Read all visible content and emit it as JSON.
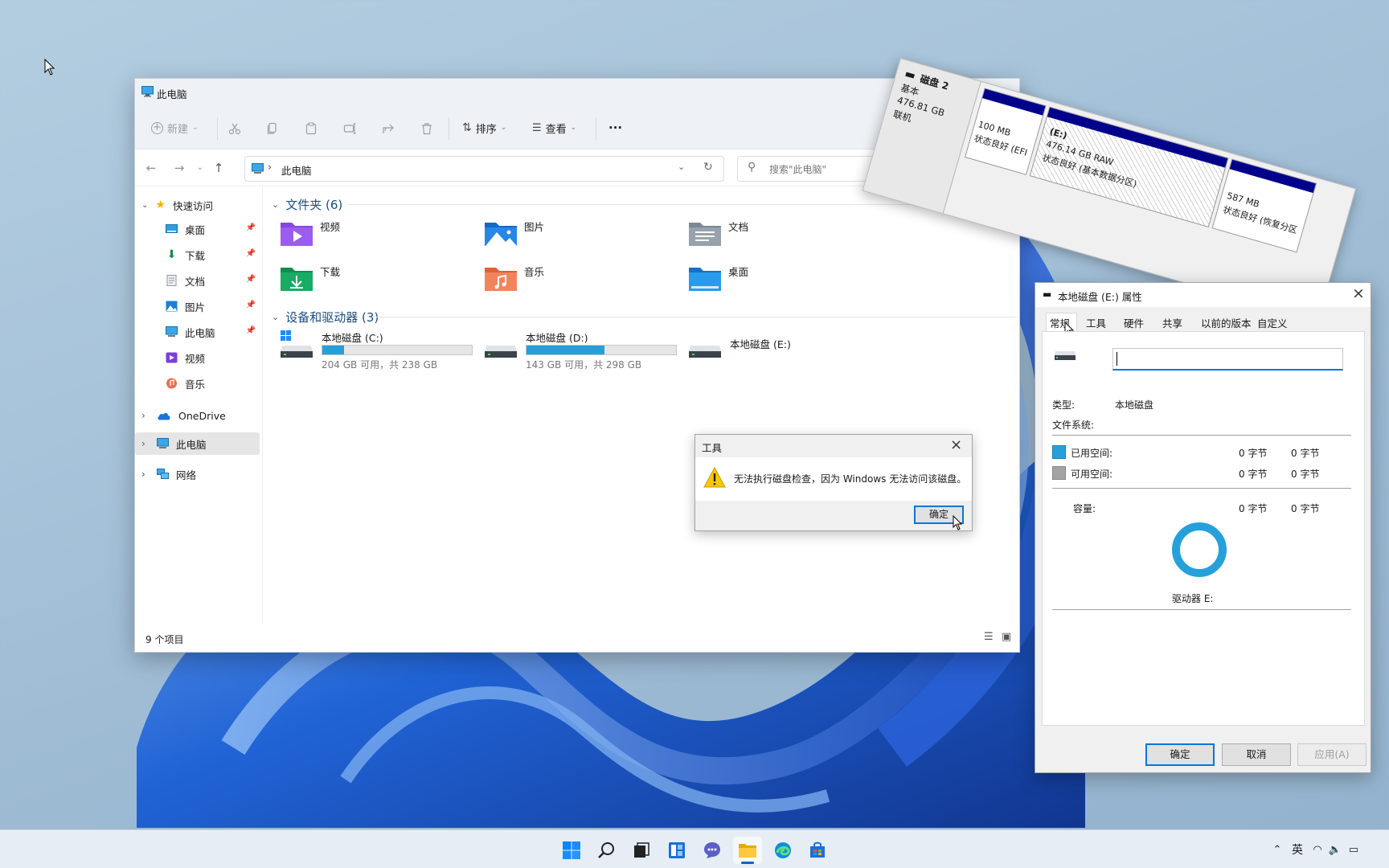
{
  "colors": {
    "accent": "#0078d7",
    "bar": "#26a0da",
    "used_swatch": "#26a0da",
    "free_swatch": "#a3a3a3",
    "disk_header": "#00008b",
    "warning": "#f8c900"
  },
  "explorer": {
    "title": "此电脑",
    "toolbar": {
      "new": "新建",
      "sort": "排序",
      "view": "查看",
      "more": "···"
    },
    "address": {
      "path": "此电脑"
    },
    "search": {
      "placeholder": "搜索\"此电脑\""
    },
    "sidebar": {
      "quick_access": "快速访问",
      "items": [
        {
          "label": "桌面",
          "icon": "desktop-icon",
          "pinned": true
        },
        {
          "label": "下载",
          "icon": "download-icon",
          "pinned": true
        },
        {
          "label": "文档",
          "icon": "document-icon",
          "pinned": true
        },
        {
          "label": "图片",
          "icon": "pictures-icon",
          "pinned": true
        },
        {
          "label": "此电脑",
          "icon": "computer-icon",
          "pinned": true
        },
        {
          "label": "视频",
          "icon": "video-icon",
          "pinned": false
        },
        {
          "label": "音乐",
          "icon": "music-icon",
          "pinned": false
        }
      ],
      "onedrive": "OneDrive",
      "this_pc": "此电脑",
      "network": "网络"
    },
    "folders_group": "文件夹 (6)",
    "folders": [
      {
        "label": "视频",
        "icon": "video-folder-icon"
      },
      {
        "label": "图片",
        "icon": "pictures-folder-icon"
      },
      {
        "label": "文档",
        "icon": "documents-folder-icon"
      },
      {
        "label": "下载",
        "icon": "downloads-folder-icon"
      },
      {
        "label": "音乐",
        "icon": "music-folder-icon"
      },
      {
        "label": "桌面",
        "icon": "desktop-folder-icon"
      }
    ],
    "drives_group": "设备和驱动器 (3)",
    "drives": [
      {
        "name": "本地磁盘 (C:)",
        "detail": "204 GB 可用，共 238 GB",
        "used_fraction": 0.143
      },
      {
        "name": "本地磁盘 (D:)",
        "detail": "143 GB 可用，共 298 GB",
        "used_fraction": 0.52
      },
      {
        "name": "本地磁盘 (E:)",
        "detail": "",
        "used_fraction": null
      }
    ],
    "status": "9 个项目"
  },
  "tool_dialog": {
    "title": "工具",
    "message": "无法执行磁盘检查，因为 Windows 无法访问该磁盘。",
    "ok": "确定"
  },
  "disk_mgmt": {
    "disk_name": "磁盘 2",
    "disk_type": "基本",
    "disk_size": "476.81 GB",
    "disk_state": "联机",
    "partitions": [
      {
        "size": "100 MB",
        "status": "状态良好 (EFI"
      },
      {
        "label": "(E:)",
        "size": "476.14 GB RAW",
        "status": "状态良好 (基本数据分区)"
      },
      {
        "size": "587 MB",
        "status": "状态良好 (恢复分区"
      }
    ]
  },
  "properties": {
    "title": "本地磁盘 (E:) 属性",
    "tabs": [
      "常规",
      "工具",
      "硬件",
      "共享",
      "以前的版本",
      "自定义"
    ],
    "volume_label": "",
    "type_label": "类型:",
    "type_value": "本地磁盘",
    "fs_label": "文件系统:",
    "fs_value": "",
    "used_label": "已用空间:",
    "used_bytes": "0 字节",
    "used_size": "0 字节",
    "free_label": "可用空间:",
    "free_bytes": "0 字节",
    "free_size": "0 字节",
    "capacity_label": "容量:",
    "capacity_bytes": "0 字节",
    "capacity_size": "0 字节",
    "drive_label": "驱动器 E:",
    "ok": "确定",
    "cancel": "取消",
    "apply": "应用(A)"
  },
  "taskbar": {
    "icons": [
      "windows-start-icon",
      "search-icon",
      "task-view-icon",
      "widgets-icon",
      "chat-icon",
      "file-explorer-icon",
      "edge-icon",
      "store-icon"
    ],
    "ime": "英"
  }
}
